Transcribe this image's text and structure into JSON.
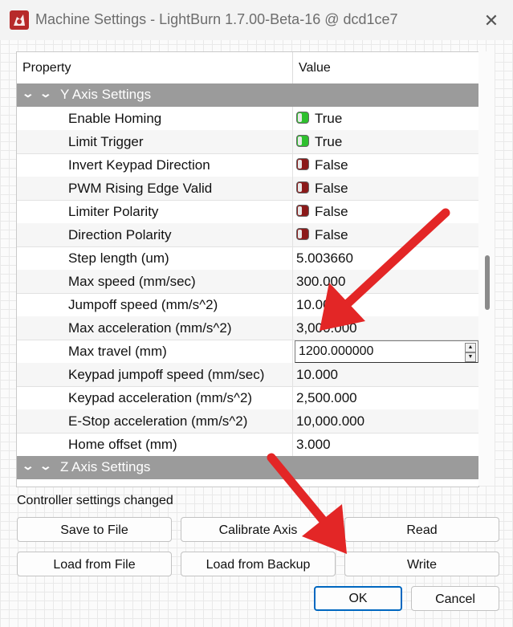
{
  "window": {
    "title": "Machine Settings - LightBurn 1.7.00-Beta-16 @ dcd1ce7",
    "close_glyph": "✕"
  },
  "table": {
    "headers": {
      "property": "Property",
      "value": "Value"
    },
    "sections": [
      {
        "label": "Y Axis Settings"
      },
      {
        "label": "Z Axis Settings"
      }
    ],
    "rows": [
      {
        "name": "Enable Homing",
        "value": "True",
        "toggle": "on"
      },
      {
        "name": "Limit Trigger",
        "value": "True",
        "toggle": "on"
      },
      {
        "name": "Invert Keypad Direction",
        "value": "False",
        "toggle": "off"
      },
      {
        "name": "PWM Rising Edge Valid",
        "value": "False",
        "toggle": "off"
      },
      {
        "name": "Limiter Polarity",
        "value": "False",
        "toggle": "off"
      },
      {
        "name": "Direction Polarity",
        "value": "False",
        "toggle": "off"
      },
      {
        "name": "Step length (um)",
        "value": "5.003660"
      },
      {
        "name": "Max speed (mm/sec)",
        "value": "300.000"
      },
      {
        "name": "Jumpoff speed (mm/s^2)",
        "value": "10.000"
      },
      {
        "name": "Max acceleration (mm/s^2)",
        "value": "3,000.000"
      },
      {
        "name": "Max travel (mm)",
        "value": "1200.000000",
        "editing": true
      },
      {
        "name": "Keypad jumpoff speed (mm/sec)",
        "value": "10.000"
      },
      {
        "name": "Keypad acceleration (mm/s^2)",
        "value": "2,500.000"
      },
      {
        "name": "E-Stop acceleration (mm/s^2)",
        "value": "10,000.000"
      },
      {
        "name": "Home offset (mm)",
        "value": "3.000"
      }
    ]
  },
  "status": "Controller settings changed",
  "buttons": {
    "save_to_file": "Save to File",
    "calibrate_axis": "Calibrate Axis",
    "read": "Read",
    "load_from_file": "Load from File",
    "load_from_backup": "Load from Backup",
    "write": "Write",
    "ok": "OK",
    "cancel": "Cancel"
  },
  "colors": {
    "section_bg": "#9b9b9b",
    "toggle_on": "#2ec02e",
    "toggle_off": "#8b1a1a",
    "annotation_arrow": "#e32626",
    "primary_border": "#0067c0"
  }
}
